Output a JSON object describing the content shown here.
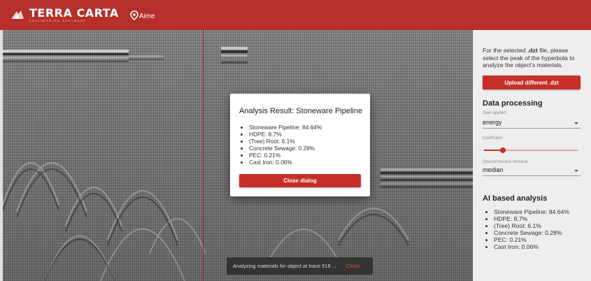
{
  "app": {
    "logo_text": "TERRA CARTA",
    "logo_subtitle": "ENGINEERING SOFTWARE",
    "aime_label": "Aime",
    "brand_color": "#b5302a"
  },
  "panel": {
    "intro_pre": "For the selected ",
    "intro_bold": ".dzt",
    "intro_post": " file, please select the peak of the hyperbola to analyze the object's materials.",
    "upload_button": "Upload different .dzt",
    "data_processing_title": "Data processing",
    "gain_label": "Gain applied",
    "gain_value": "energy",
    "coefficient_label": "Coefficient",
    "coefficient_level": 0.2,
    "ground_bounce_label": "Ground bounce removal",
    "ground_bounce_value": "median",
    "ai_title": "AI based analysis",
    "ai_results": [
      "Stoneware Pipeline: 84.64%",
      "HDPE: 8.7%",
      "(Tree) Root: 6.1%",
      "Concrete Sewage: 0.28%",
      "PEC: 0.21%",
      "Cast Iron: 0.06%"
    ]
  },
  "dialog": {
    "title": "Analysis Result: Stoneware Pipeline",
    "results": [
      "Stoneware Pipeline: 84.64%",
      "HDPE: 8.7%",
      "(Tree) Root: 6.1%",
      "Concrete Sewage: 0.28%",
      "PEC: 0.21%",
      "Cast Iron: 0.06%"
    ],
    "close_button": "Close dialog"
  },
  "snackbar": {
    "message": "Analyzing materials for object at trace 518 ...",
    "action": "Close"
  }
}
